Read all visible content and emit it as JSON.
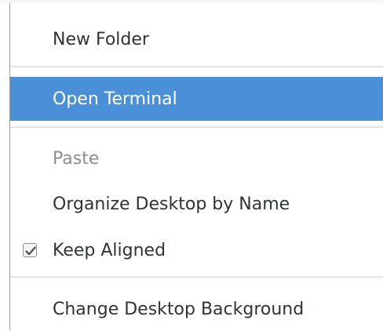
{
  "menu": {
    "items": [
      {
        "label": "New Folder"
      },
      {
        "label": "Open Terminal"
      },
      {
        "label": "Paste"
      },
      {
        "label": "Organize Desktop by Name"
      },
      {
        "label": "Keep Aligned",
        "checked": true
      },
      {
        "label": "Change Desktop Background"
      }
    ]
  },
  "colors": {
    "highlight": "#4a90d9",
    "text": "#2e3436",
    "disabled_text": "#8b8e8f"
  },
  "icons": {
    "checkmark": "check-icon"
  }
}
